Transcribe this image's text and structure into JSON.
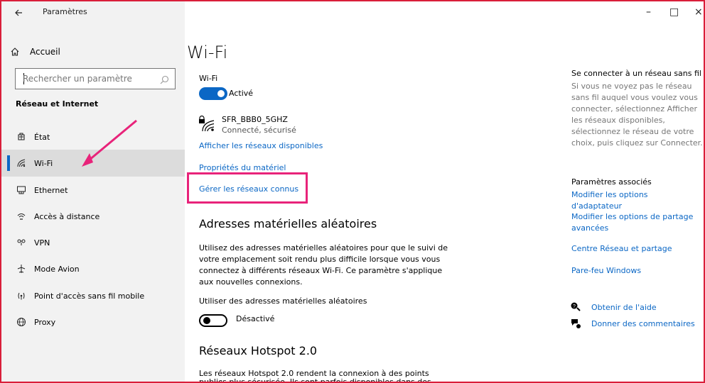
{
  "window": {
    "title": "Paramètres",
    "controls": {
      "minimize": "–",
      "maximize": "□",
      "close": "×"
    }
  },
  "sidebar": {
    "back_icon": "back-arrow-icon",
    "home": {
      "label": "Accueil",
      "icon": "home-icon"
    },
    "search": {
      "placeholder": "Rechercher un paramètre",
      "icon": "search-icon"
    },
    "section_title": "Réseau et Internet",
    "items": [
      {
        "label": "État",
        "icon": "status-globe-icon",
        "selected": false
      },
      {
        "label": "Wi-Fi",
        "icon": "wifi-icon",
        "selected": true
      },
      {
        "label": "Ethernet",
        "icon": "ethernet-icon",
        "selected": false
      },
      {
        "label": "Accès à distance",
        "icon": "dial-up-icon",
        "selected": false
      },
      {
        "label": "VPN",
        "icon": "vpn-icon",
        "selected": false
      },
      {
        "label": "Mode Avion",
        "icon": "airplane-icon",
        "selected": false
      },
      {
        "label": "Point d'accès sans fil mobile",
        "icon": "hotspot-icon",
        "selected": false
      },
      {
        "label": "Proxy",
        "icon": "proxy-globe-icon",
        "selected": false
      }
    ]
  },
  "content": {
    "page_title": "Wi-Fi",
    "wifi_section": {
      "label": "Wi-Fi",
      "toggle_state": "Activé",
      "toggle_on": true
    },
    "network": {
      "ssid": "SFR_BBB0_5GHZ",
      "status": "Connecté, sécurisé"
    },
    "links": {
      "show_networks": "Afficher les réseaux disponibles",
      "hardware_props": "Propriétés du matériel",
      "manage_known": "Gérer les réseaux connus"
    },
    "random_hw": {
      "heading": "Adresses matérielles aléatoires",
      "description": "Utilisez des adresses matérielles aléatoires pour que le suivi de votre emplacement soit rendu plus difficile lorsque vous vous connectez à différents réseaux Wi-Fi. Ce paramètre s'applique aux nouvelles connexions.",
      "toggle_label": "Utiliser des adresses matérielles aléatoires",
      "toggle_state": "Désactivé",
      "toggle_on": false
    },
    "hotspot": {
      "heading": "Réseaux Hotspot 2.0",
      "description_line1": "Les réseaux Hotspot 2.0 rendent la connexion à des points d'accès Wi-Fi",
      "description_line2": "publics plus sécurisée. Ils sont parfois disponibles dans des espaces"
    }
  },
  "rail": {
    "connect_title": "Se connecter à un réseau sans fil",
    "connect_text": "Si vous ne voyez pas le réseau sans fil auquel vous voulez vous connecter, sélectionnez Afficher les réseaux disponibles, sélectionnez le réseau de votre choix, puis cliquez sur Connecter.",
    "related_title": "Paramètres associés",
    "related_links": [
      "Modifier les options d'adaptateur",
      "Modifier les options de partage avancées",
      "Centre Réseau et partage",
      "Pare-feu Windows"
    ],
    "help": {
      "label": "Obtenir de l'aide",
      "icon": "help-icon"
    },
    "feedback": {
      "label": "Donner des commentaires",
      "icon": "feedback-icon"
    }
  },
  "annotations": {
    "accent_color": "#0b67c5",
    "highlight_color": "#e8237a",
    "frame_color": "#d91e3a"
  }
}
